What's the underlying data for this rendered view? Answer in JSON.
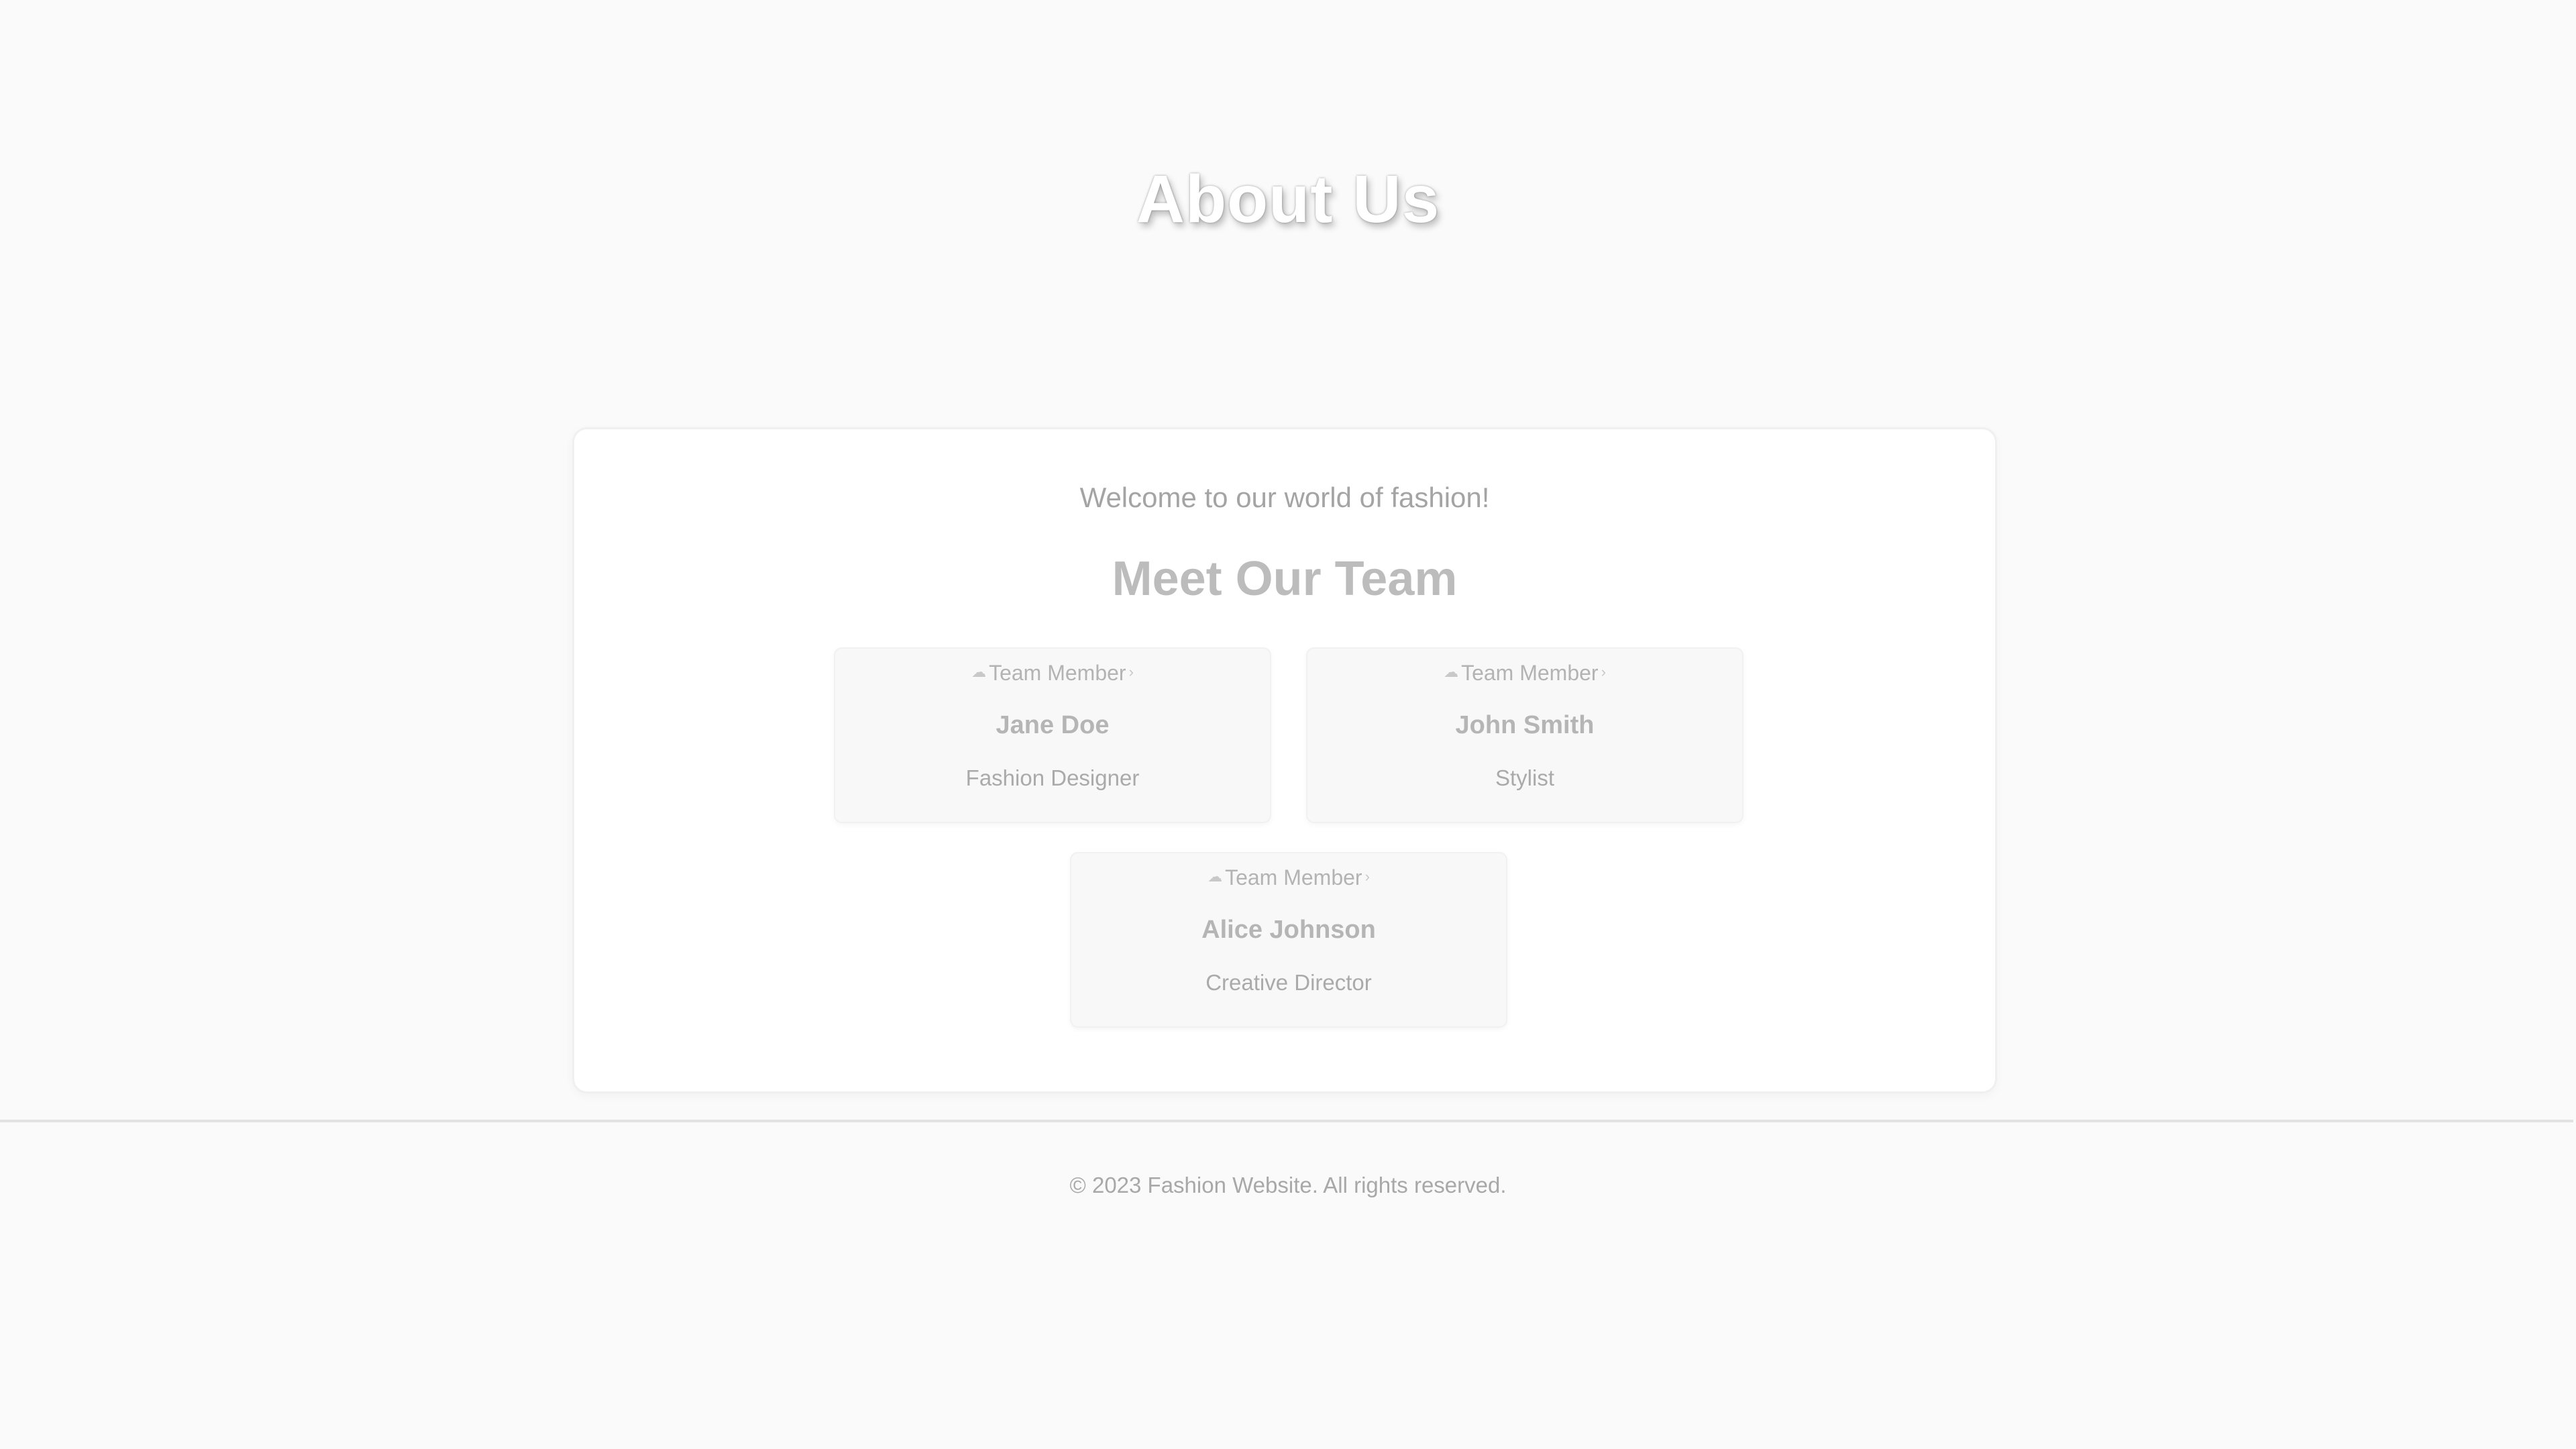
{
  "hero": {
    "title": "About Us"
  },
  "intro": {
    "welcome": "Welcome to our world of fashion!"
  },
  "team": {
    "heading": "Meet Our Team",
    "members": [
      {
        "image_alt": "Team Member",
        "name": "Jane Doe",
        "role": "Fashion Designer"
      },
      {
        "image_alt": "Team Member",
        "name": "John Smith",
        "role": "Stylist"
      },
      {
        "image_alt": "Team Member",
        "name": "Alice Johnson",
        "role": "Creative Director"
      }
    ]
  },
  "footer": {
    "copyright": "© 2023 Fashion Website. All rights reserved."
  },
  "colors": {
    "page_background": "#fafafa",
    "card_background": "#ffffff",
    "member_card_background": "#f8f8f8",
    "hero_title": "#ffffff",
    "muted_text": "#a8a8a8"
  },
  "icons": {
    "broken_image": "broken-image-icon"
  }
}
